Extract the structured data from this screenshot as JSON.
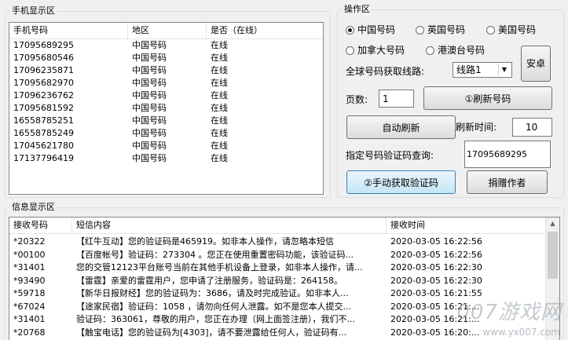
{
  "phone_group": {
    "title": "手机显示区",
    "columns": [
      "手机号码",
      "地区",
      "是否（在线）"
    ],
    "rows": [
      [
        "17095689295",
        "中国号码",
        "在线"
      ],
      [
        "17095680546",
        "中国号码",
        "在线"
      ],
      [
        "17096235871",
        "中国号码",
        "在线"
      ],
      [
        "17095682970",
        "中国号码",
        "在线"
      ],
      [
        "17096236762",
        "中国号码",
        "在线"
      ],
      [
        "17095681592",
        "中国号码",
        "在线"
      ],
      [
        "16558785251",
        "中国号码",
        "在线"
      ],
      [
        "16558785249",
        "中国号码",
        "在线"
      ],
      [
        "17045621780",
        "中国号码",
        "在线"
      ],
      [
        "17137796419",
        "中国号码",
        "在线"
      ]
    ]
  },
  "ops": {
    "title": "操作区",
    "radios": [
      {
        "label": "中国号码",
        "checked": true
      },
      {
        "label": "英国号码",
        "checked": false
      },
      {
        "label": "美国号码",
        "checked": false
      },
      {
        "label": "加拿大号码",
        "checked": false
      },
      {
        "label": "港澳台号码",
        "checked": false
      }
    ],
    "android_button": "安卓",
    "route_label": "全球号码获取线路:",
    "route_value": "线路1",
    "page_label": "页数:",
    "page_value": "1",
    "refresh_button": "①刷新号码",
    "auto_refresh_button": "自动刷新",
    "refresh_time_label": "刷新时间:",
    "refresh_time_value": "10",
    "query_label": "指定号码验证码查询:",
    "query_value": "17095689295",
    "manual_button": "②手动获取验证码",
    "donate_button": "捐赠作者"
  },
  "info_group": {
    "title": "信息显示区",
    "columns": [
      "接收号码",
      "短信内容",
      "接收时间"
    ],
    "rows": [
      [
        "*20322",
        "【红牛互动】您的验证码是465919。如非本人操作，请忽略本短信",
        "2020-03-05  16:22:56"
      ],
      [
        "*00100",
        "【百度帐号】验证码：273304 。您正在使用重置密码功能，该验证码...",
        "2020-03-05  16:22:56"
      ],
      [
        "*31401",
        "您的交管12123平台账号当前在其他手机设备上登录，如非本人操作，请...",
        "2020-03-05  16:22:30"
      ],
      [
        "*93490",
        "【雷霆】亲爱的雷霆用户，您申请了注册服务，验证码是：264158。",
        "2020-03-05  16:22:30"
      ],
      [
        "*59718",
        "【新华日报财经】您的验证码为：3686，请及时完成验证。如非本人...",
        "2020-03-05  16:21:55"
      ],
      [
        "*67024",
        "【途家民宿】验证码：1058 ，请勿向任何人泄露。如不是您本人提交...",
        "2020-03-05  16:21:..."
      ],
      [
        "*31401",
        "验证码：363061，尊敬的用户，您正在办理（网上面签注册），我们不...",
        "2020-03-05  16:21:..."
      ],
      [
        "*20768",
        "【触宝电话】您的验证码为[4303]，请不要泄露给任何人，验证码有...",
        "2020-03-05  16:20:..."
      ]
    ]
  },
  "watermark": {
    "text": "007游戏网",
    "url": "www.yx007.com"
  }
}
